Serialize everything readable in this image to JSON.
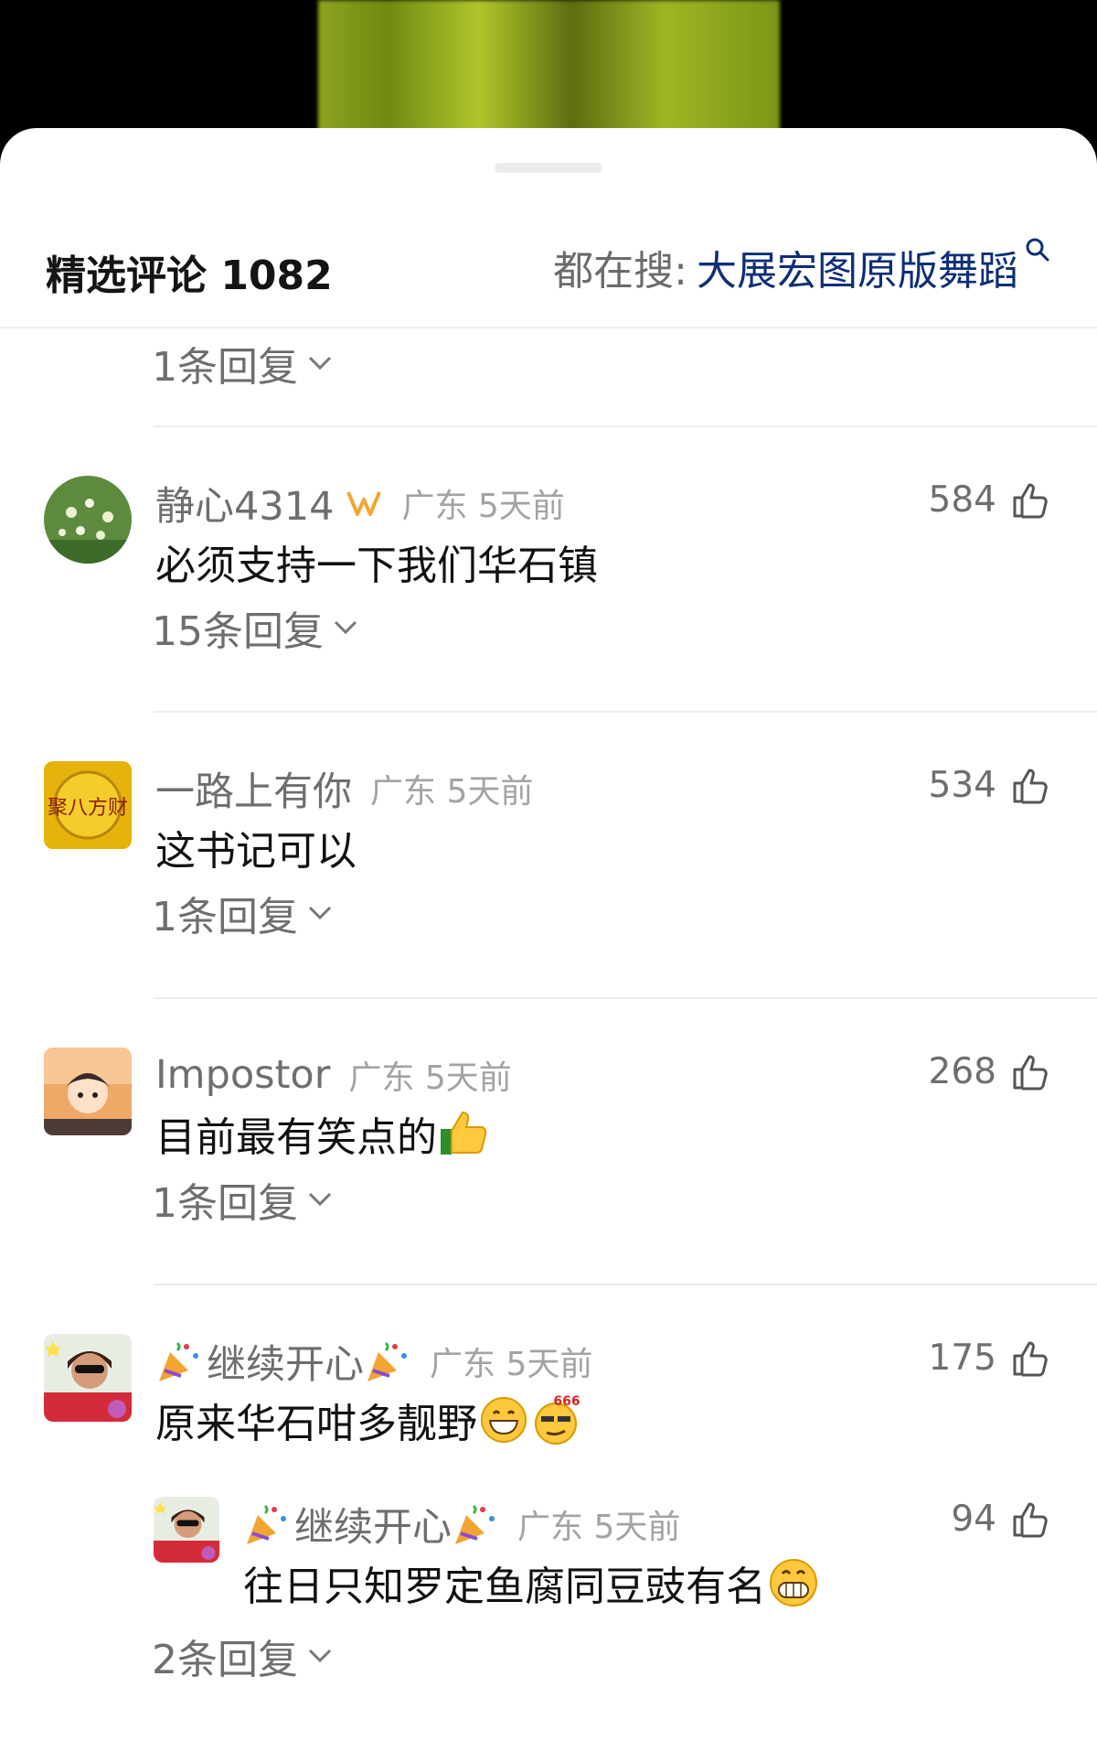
{
  "header": {
    "title": "精选评论 1082",
    "search_prefix": "都在搜:",
    "search_keyword": "大展宏图原版舞蹈"
  },
  "top_reply_toggle": "1条回复",
  "comments": [
    {
      "username": "静心4314",
      "location_time": "广东 5天前",
      "likes": "584",
      "text": "必须支持一下我们华石镇",
      "reply_toggle": "15条回复"
    },
    {
      "username": "一路上有你",
      "location_time": "广东 5天前",
      "likes": "534",
      "text": "这书记可以",
      "reply_toggle": "1条回复",
      "avatar_text": "聚八方财"
    },
    {
      "username": "Impostor",
      "location_time": "广东 5天前",
      "likes": "268",
      "text": "目前最有笑点的",
      "reply_toggle": "1条回复"
    },
    {
      "username": "继续开心",
      "location_time": "广东 5天前",
      "likes": "175",
      "text": "原来华石咁多靓野",
      "emoji_badge": "666",
      "reply": {
        "username": "继续开心",
        "location_time": "广东 5天前",
        "likes": "94",
        "text": "往日只知罗定鱼腐同豆豉有名"
      },
      "reply_toggle": "2条回复"
    }
  ],
  "colors": {
    "keyword": "#0e2f76",
    "muted": "#6e6e6e",
    "meta": "#a3a3a3"
  }
}
